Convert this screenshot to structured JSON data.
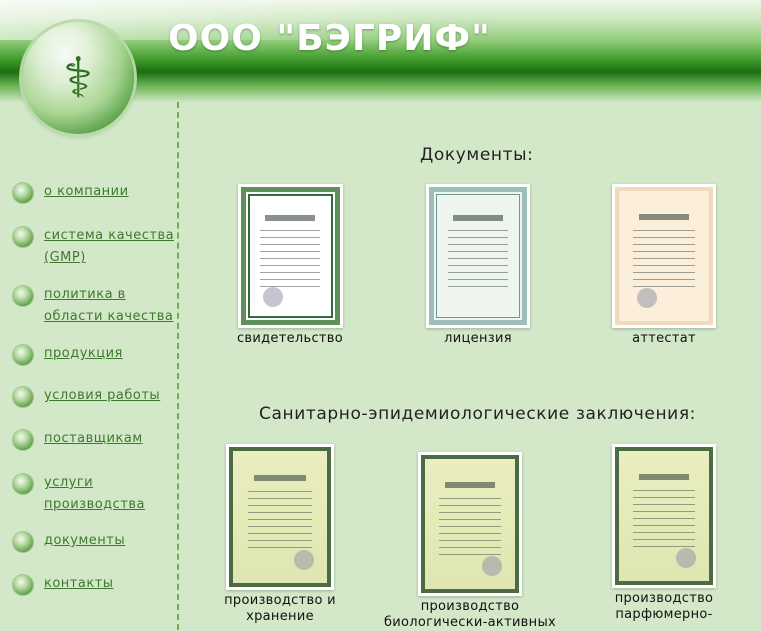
{
  "site": {
    "title": "ООО \"БЭГРИФ\""
  },
  "nav": [
    {
      "label": "о компании"
    },
    {
      "label": "система качества\n(GMP)"
    },
    {
      "label": "политика в\nобласти качества"
    },
    {
      "label": "продукция"
    },
    {
      "label": "условия работы"
    },
    {
      "label": "поставщикам"
    },
    {
      "label": "услуги\nпроизводства"
    },
    {
      "label": "документы"
    },
    {
      "label": "контакты"
    }
  ],
  "documents": {
    "title": "Документы:",
    "items": [
      {
        "caption": "свидетельство"
      },
      {
        "caption": "лицензия"
      },
      {
        "caption": "аттестат"
      }
    ]
  },
  "conclusions": {
    "title": "Санитарно-эпидемиологические заключения:",
    "items": [
      {
        "caption": "производство и\nхранение"
      },
      {
        "caption": "производство\nбиологически-активных"
      },
      {
        "caption": "производство\nпарфюмерно-"
      }
    ]
  },
  "colors": {
    "accent": "#3d7a2c",
    "background": "#d3e8c9",
    "header_dark": "#1d6e14"
  },
  "icons": {
    "logo": "caduceus-icon",
    "bullet": "green-bullet-icon"
  }
}
